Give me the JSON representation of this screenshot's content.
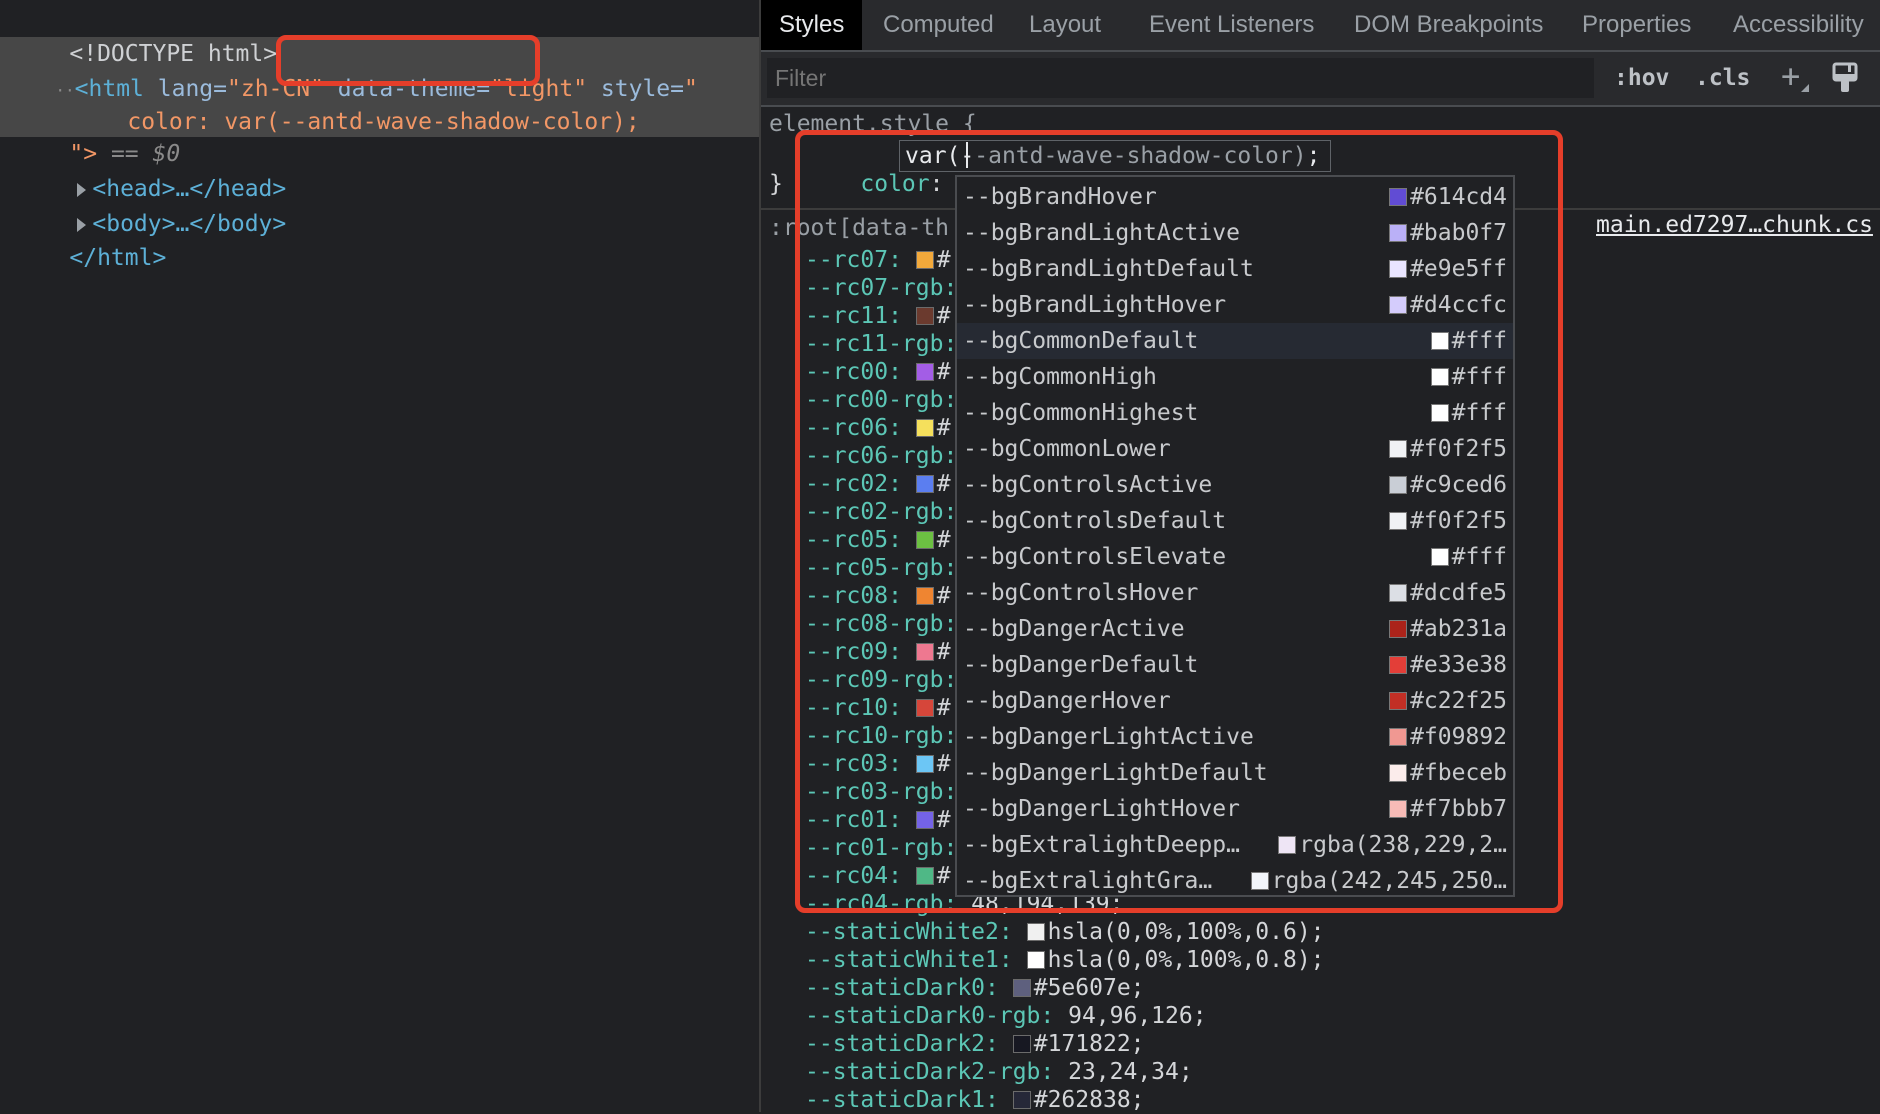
{
  "elements_panel": {
    "lines": [
      {
        "doctype": "<!DOCTYPE html>"
      },
      {
        "html_open_prefix": "<html ",
        "lang_attr": "lang=",
        "lang_val": "\"zh-CN\"",
        "theme_attr": "data-theme=",
        "theme_val": "\"light\"",
        "style_attr": "style=",
        "style_open": "\""
      },
      {
        "style_body": "color: var(--antd-wave-shadow-color);"
      },
      {
        "close_quote": "\">",
        "eq": " == ",
        "dollar": "$0"
      },
      {
        "head": "<head>…</head>"
      },
      {
        "body": "<body>…</body>"
      },
      {
        "html_close": "</html>"
      }
    ]
  },
  "styles_panel": {
    "tabs": [
      {
        "label": "Styles",
        "active": true
      },
      {
        "label": "Computed"
      },
      {
        "label": "Layout"
      },
      {
        "label": "Event Listeners"
      },
      {
        "label": "DOM Breakpoints"
      },
      {
        "label": "Properties"
      },
      {
        "label": "Accessibility"
      }
    ],
    "filter_placeholder": "Filter",
    "toolbar": {
      "hov": ":hov",
      "cls": ".cls",
      "plus": "+"
    },
    "element_style": {
      "selector": "element.style {",
      "prop": "color",
      "value_before_caret": "var(-",
      "value_after_caret": "-antd-wave-shadow-color)",
      "semicolon": ";",
      "close": "}"
    },
    "root_rule": {
      "selector": ":root[data-th",
      "source_link": "main.ed7297…chunk.cs",
      "declarations": [
        {
          "name": "--rc07:",
          "swatch": "#f2a93b",
          "value": "#"
        },
        {
          "name": "--rc07-rgb:",
          "value": ""
        },
        {
          "name": "--rc11:",
          "swatch": "#6b3a2e",
          "value": "#"
        },
        {
          "name": "--rc11-rgb:",
          "value": ""
        },
        {
          "name": "--rc00:",
          "swatch": "#a35de6",
          "value": "#"
        },
        {
          "name": "--rc00-rgb:",
          "value": ""
        },
        {
          "name": "--rc06:",
          "swatch": "#f5e05c",
          "value": "#"
        },
        {
          "name": "--rc06-rgb:",
          "value": ""
        },
        {
          "name": "--rc02:",
          "swatch": "#5b7ef0",
          "value": "#"
        },
        {
          "name": "--rc02-rgb:",
          "value": ""
        },
        {
          "name": "--rc05:",
          "swatch": "#6cc042",
          "value": "#"
        },
        {
          "name": "--rc05-rgb:",
          "value": ""
        },
        {
          "name": "--rc08:",
          "swatch": "#ef8531",
          "value": "#"
        },
        {
          "name": "--rc08-rgb:",
          "value": ""
        },
        {
          "name": "--rc09:",
          "swatch": "#ee7890",
          "value": "#"
        },
        {
          "name": "--rc09-rgb:",
          "value": ""
        },
        {
          "name": "--rc10:",
          "swatch": "#d6463a",
          "value": "#"
        },
        {
          "name": "--rc10-rgb:",
          "value": ""
        },
        {
          "name": "--rc03:",
          "swatch": "#6cc6f5",
          "value": "#"
        },
        {
          "name": "--rc03-rgb:",
          "value": ""
        },
        {
          "name": "--rc01:",
          "swatch": "#7463e6",
          "value": "#"
        },
        {
          "name": "--rc01-rgb:",
          "value": ""
        },
        {
          "name": "--rc04:",
          "swatch": "#4fb886",
          "value": "#"
        },
        {
          "name": "--rc04-rgb:",
          "value": " 48,194,139;"
        },
        {
          "name": "--staticWhite2:",
          "swatch": "#f0f0f0",
          "value": "hsla(0,0%,100%,0.6);"
        },
        {
          "name": "--staticWhite1:",
          "swatch": "#ffffff",
          "value": "hsla(0,0%,100%,0.8);"
        },
        {
          "name": "--staticDark0:",
          "swatch": "#5e607e",
          "value": "#5e607e;"
        },
        {
          "name": "--staticDark0-rgb:",
          "value": " 94,96,126;"
        },
        {
          "name": "--staticDark2:",
          "swatch": "#171822",
          "value": "#171822;"
        },
        {
          "name": "--staticDark2-rgb:",
          "value": " 23,24,34;"
        },
        {
          "name": "--staticDark1:",
          "swatch": "#262838",
          "value": "#262838;"
        }
      ]
    },
    "autocomplete": {
      "highlighted_index": 4,
      "items": [
        {
          "name": "--bgBrandHover",
          "swatch": "#614cd4",
          "value": "#614cd4"
        },
        {
          "name": "--bgBrandLightActive",
          "swatch": "#bab0f7",
          "value": "#bab0f7"
        },
        {
          "name": "--bgBrandLightDefault",
          "swatch": "#e9e5ff",
          "value": "#e9e5ff"
        },
        {
          "name": "--bgBrandLightHover",
          "swatch": "#d4ccfc",
          "value": "#d4ccfc"
        },
        {
          "name": "--bgCommonDefault",
          "swatch": "#ffffff",
          "value": "#fff"
        },
        {
          "name": "--bgCommonHigh",
          "swatch": "#ffffff",
          "value": "#fff"
        },
        {
          "name": "--bgCommonHighest",
          "swatch": "#ffffff",
          "value": "#fff"
        },
        {
          "name": "--bgCommonLower",
          "swatch": "#f0f2f5",
          "value": "#f0f2f5"
        },
        {
          "name": "--bgControlsActive",
          "swatch": "#c9ced6",
          "value": "#c9ced6"
        },
        {
          "name": "--bgControlsDefault",
          "swatch": "#f0f2f5",
          "value": "#f0f2f5"
        },
        {
          "name": "--bgControlsElevate",
          "swatch": "#ffffff",
          "value": "#fff"
        },
        {
          "name": "--bgControlsHover",
          "swatch": "#dcdfe5",
          "value": "#dcdfe5"
        },
        {
          "name": "--bgDangerActive",
          "swatch": "#ab231a",
          "value": "#ab231a"
        },
        {
          "name": "--bgDangerDefault",
          "swatch": "#e33e38",
          "value": "#e33e38"
        },
        {
          "name": "--bgDangerHover",
          "swatch": "#c22f25",
          "value": "#c22f25"
        },
        {
          "name": "--bgDangerLightActive",
          "swatch": "#f09892",
          "value": "#f09892"
        },
        {
          "name": "--bgDangerLightDefault",
          "swatch": "#fbeceb",
          "value": "#fbeceb"
        },
        {
          "name": "--bgDangerLightHover",
          "swatch": "#f7bbb7",
          "value": "#f7bbb7"
        },
        {
          "name": "--bgExtralightDeepp…",
          "swatch": "#eee5f5",
          "value": "rgba(238,229,2…"
        },
        {
          "name": "--bgExtralightGra…",
          "swatch": "#f2f5fa",
          "value": "rgba(242,245,250…"
        }
      ]
    }
  },
  "annotation_color": "#e53e2a"
}
